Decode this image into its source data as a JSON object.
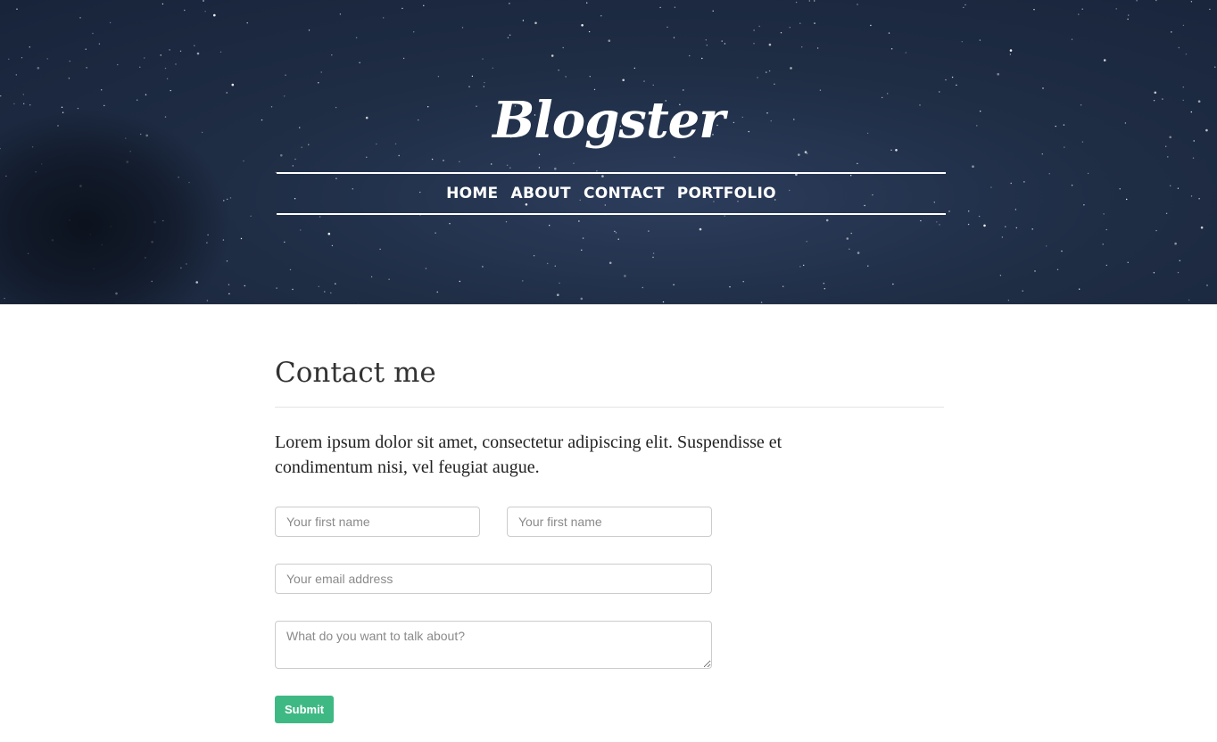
{
  "site": {
    "logo": "Blogster"
  },
  "nav": {
    "items": [
      {
        "label": "HOME"
      },
      {
        "label": "ABOUT"
      },
      {
        "label": "CONTACT",
        "active": true
      },
      {
        "label": "PORTFOLIO"
      }
    ]
  },
  "page": {
    "title": "Contact me",
    "lead": "Lorem ipsum dolor sit amet, consectetur adipiscing elit. Suspendisse et condimentum nisi, vel feugiat augue."
  },
  "form": {
    "first_name_placeholder": "Your first name",
    "last_name_placeholder": "Your first name",
    "email_placeholder": "Your email address",
    "message_placeholder": "What do you want to talk about?",
    "submit_label": "Submit"
  },
  "colors": {
    "hero_background": "#1f2d45",
    "accent_button": "#3fb984"
  }
}
